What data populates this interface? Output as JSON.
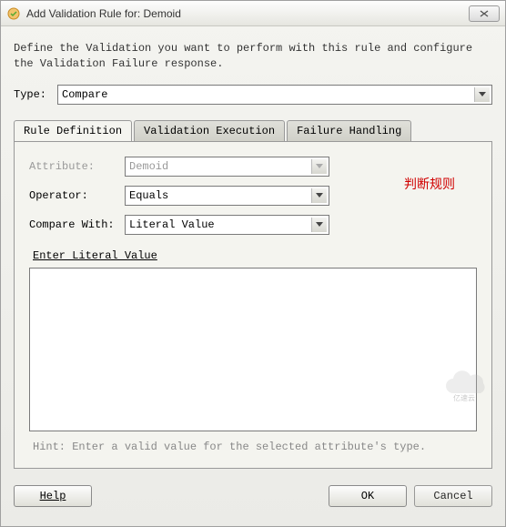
{
  "titlebar": {
    "icon_name": "validation-icon",
    "title": "Add Validation Rule for: Demoid",
    "close_label": "×"
  },
  "intro": "Define the Validation you want to perform with this rule and configure the Validation Failure response.",
  "type": {
    "label": "Type:",
    "value": "Compare"
  },
  "tabs": [
    {
      "label": "Rule Definition",
      "active": true
    },
    {
      "label": "Validation Execution",
      "active": false
    },
    {
      "label": "Failure Handling",
      "active": false
    }
  ],
  "form": {
    "attribute": {
      "label": "Attribute:",
      "value": "Demoid",
      "disabled": true
    },
    "operator": {
      "label": "Operator:",
      "value": "Equals"
    },
    "compare": {
      "label": "Compare With:",
      "value": "Literal Value"
    }
  },
  "annotation": "判断规则",
  "literal": {
    "label": "Enter Literal Value",
    "value": ""
  },
  "hint": "Hint: Enter a valid value for the selected attribute's type.",
  "buttons": {
    "help": "Help",
    "ok": "OK",
    "cancel": "Cancel"
  },
  "watermark": "亿速云"
}
